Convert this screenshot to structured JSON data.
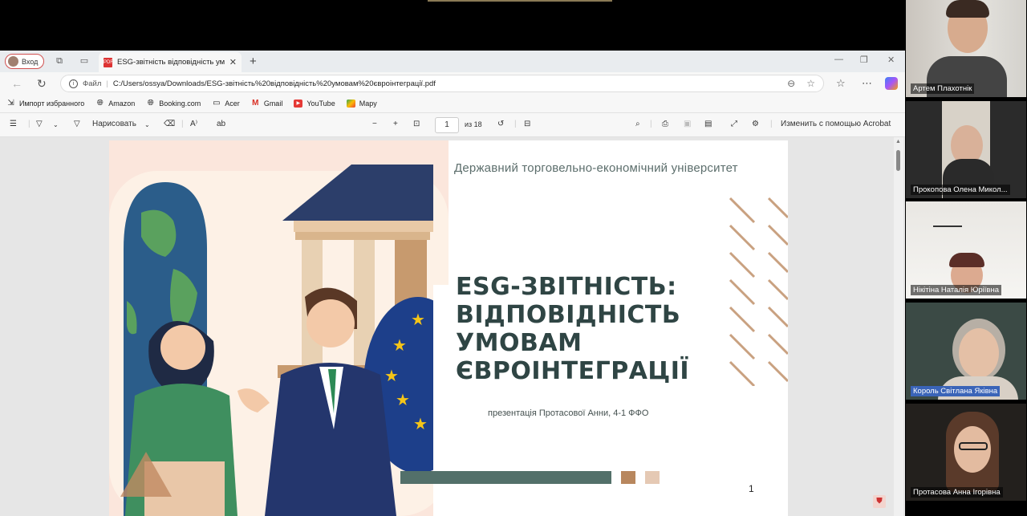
{
  "browser": {
    "profile_label": "Вход",
    "tab_title": "ESG-звітність відповідність умов",
    "address": {
      "scheme_label": "Файл",
      "url": "C:/Users/ossya/Downloads/ESG-звітність%20відповідність%20умовам%20євроінтеграції.pdf"
    },
    "bookmarks": [
      {
        "label": "Импорт избранного",
        "icon": "import-icon"
      },
      {
        "label": "Amazon",
        "icon": "globe-icon"
      },
      {
        "label": "Booking.com",
        "icon": "globe-icon"
      },
      {
        "label": "Acer",
        "icon": "folder-icon"
      },
      {
        "label": "Gmail",
        "icon": "gmail-icon"
      },
      {
        "label": "YouTube",
        "icon": "youtube-icon"
      },
      {
        "label": "Mapy",
        "icon": "map-icon"
      }
    ]
  },
  "pdf_toolbar": {
    "draw_label": "Нарисовать",
    "page_current": "1",
    "page_total": "из 18",
    "edit_label": "Изменить с помощью Acrobat"
  },
  "slide": {
    "university": "Державний торговельно-економічний університет",
    "title_lines": [
      "ESG-ЗВІТНІСТЬ:",
      "ВІДПОВІДНІСТЬ",
      "УМОВАМ",
      "ЄВРОІНТЕГРАЦІЇ"
    ],
    "subtitle": "презентація Протасової Анни, 4-1 ФФО",
    "page_number": "1",
    "colors": {
      "title": "#2f4544",
      "accent_green": "#53706a",
      "accent_brown": "#b8875e",
      "accent_beige": "#e5c9b4"
    }
  },
  "participants": [
    {
      "name": "Артем Плахотнік",
      "highlighted": false
    },
    {
      "name": "Прокопова Олена Микол...",
      "highlighted": false
    },
    {
      "name": "Нікітіна Наталія Юріївна",
      "highlighted": false
    },
    {
      "name": "Король Світлана Яківна",
      "highlighted": true
    },
    {
      "name": "Протасова Анна Ігорівна",
      "highlighted": false
    }
  ]
}
